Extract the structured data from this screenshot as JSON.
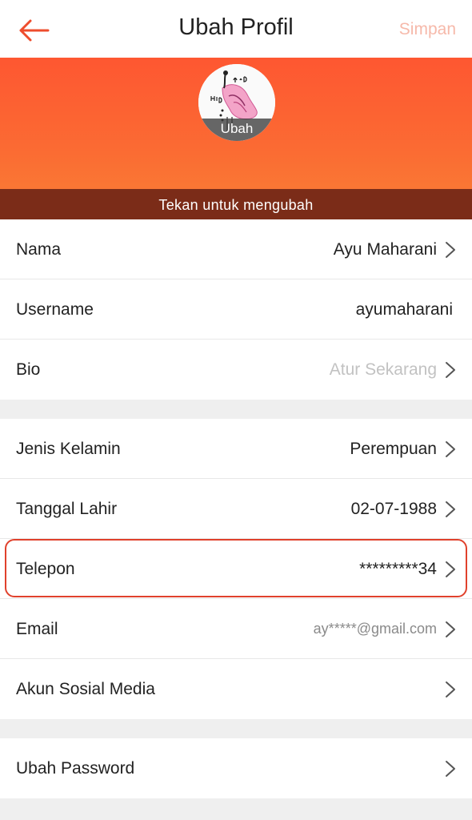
{
  "header": {
    "title": "Ubah Profil",
    "save_label": "Simpan"
  },
  "banner": {
    "avatar_overlay_label": "Ubah",
    "hint": "Tekan untuk mengubah"
  },
  "profile_rows": [
    {
      "label": "Nama",
      "value": "Ayu Maharani"
    },
    {
      "label": "Username",
      "value": "ayumaharani"
    },
    {
      "label": "Bio",
      "value": "Atur Sekarang"
    }
  ],
  "personal_rows": [
    {
      "label": "Jenis Kelamin",
      "value": "Perempuan"
    },
    {
      "label": "Tanggal Lahir",
      "value": "02-07-1988"
    },
    {
      "label": "Telepon",
      "value": "*********34"
    },
    {
      "label": "Email",
      "value": "ay*****@gmail.com"
    },
    {
      "label": "Akun Sosial Media",
      "value": ""
    }
  ],
  "account_rows": [
    {
      "label": "Ubah Password",
      "value": ""
    }
  ],
  "colors": {
    "brand": "#fe5731",
    "highlight": "#e0412c",
    "save_disabled": "#f6b9aa"
  }
}
